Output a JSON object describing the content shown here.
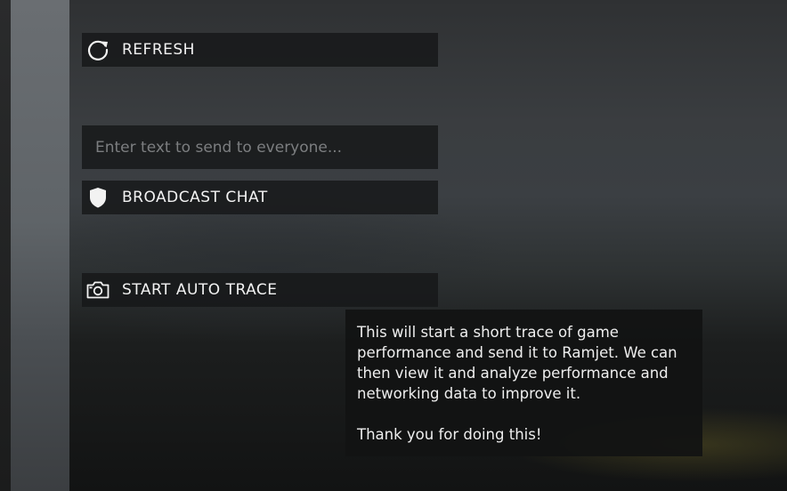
{
  "menu": {
    "refresh_label": "REFRESH",
    "refresh_icon": "refresh-icon",
    "chat_placeholder": "Enter text to send to everyone...",
    "broadcast_label": "BROADCAST CHAT",
    "broadcast_icon": "shield-icon",
    "trace_label": "START AUTO TRACE",
    "trace_icon": "camera-icon"
  },
  "tooltip": {
    "line1": "This will start a short trace of game",
    "line2": "performance and send it to Ramjet. We can",
    "line3": "then view it and analyze performance and",
    "line4": "networking data to improve it.",
    "thanks": "Thank you for doing this!"
  }
}
